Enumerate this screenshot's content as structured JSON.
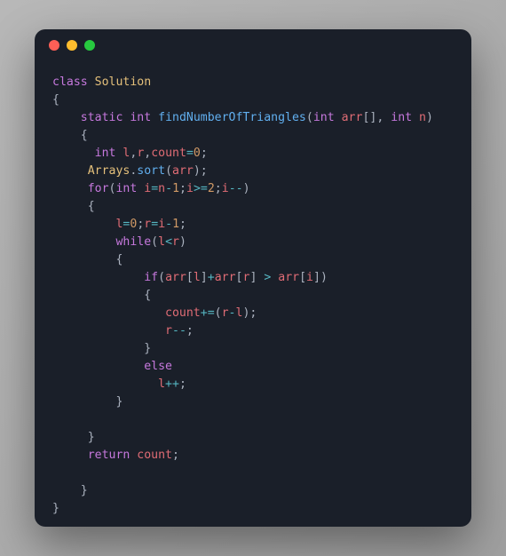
{
  "titlebar": {
    "close": "close",
    "minimize": "minimize",
    "maximize": "maximize"
  },
  "tok": {
    "class": "class",
    "Solution": "Solution",
    "static": "static",
    "int": "int",
    "findNumberOfTriangles": "findNumberOfTriangles",
    "arr": "arr",
    "n": "n",
    "l": "l",
    "r": "r",
    "count": "count",
    "Arrays": "Arrays",
    "sort": "sort",
    "for": "for",
    "i": "i",
    "while": "while",
    "if": "if",
    "else": "else",
    "return": "return",
    "zero": "0",
    "one": "1",
    "two": "2",
    "lbrace": "{",
    "rbrace": "}",
    "lparen": "(",
    "rparen": ")",
    "lbrack": "[",
    "rbrack": "]",
    "semi": ";",
    "comma": ",",
    "dot": ".",
    "eq": "=",
    "lt": "<",
    "gt": ">",
    "ge": ">=",
    "plus": "+",
    "minus": "-",
    "inc": "++",
    "dec": "--",
    "pluseq": "+=",
    "sp": " "
  }
}
